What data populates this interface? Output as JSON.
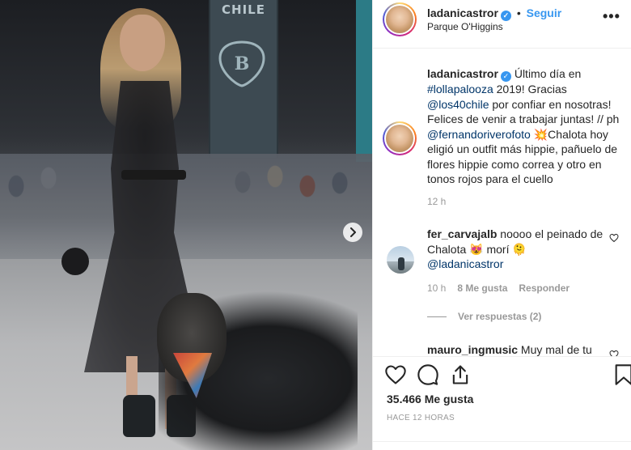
{
  "photo": {
    "banner_text": "CHILE",
    "next_icon": "chevron-right-icon"
  },
  "header": {
    "username": "ladanicastror",
    "separator": "•",
    "follow_label": "Seguir",
    "location": "Parque O'Higgins",
    "more_icon": "more-horizontal-icon",
    "more_label": "•••"
  },
  "caption": {
    "username": "ladanicastror",
    "text_1": " Último día en ",
    "hashtag": "#lollapalooza",
    "text_2": " 2019! Gracias ",
    "mention_1": "@los40chile",
    "text_3": " por confiar en nosotras! Felices de venir a trabajar juntas! // ph ",
    "mention_2": "@fernandoriverofoto",
    "emoji": "💥",
    "text_4": "Chalota hoy eligió un outfit más hippie, pañuelo de flores hippie como correa y otro en tonos rojos para el cuello",
    "time": "12 h"
  },
  "comment_1": {
    "username": "fer_carvajalb",
    "text": " noooo el peinado de Chalota ",
    "emoji": "😻",
    "text_2": " morí ",
    "trailing_glyph": "🫠",
    "mention": "@ladanicastror",
    "time": "10 h",
    "likes": "8 Me gusta",
    "reply_label": "Responder",
    "view_replies": "Ver respuestas (2)"
  },
  "comment_2": {
    "username": "mauro_ingmusic",
    "text": " Muy mal de tu"
  },
  "actions": {
    "like_icon": "heart-icon",
    "comment_icon": "comment-icon",
    "share_icon": "share-icon",
    "save_icon": "bookmark-icon",
    "likes_count": "35.466 Me gusta",
    "time_ago": "HACE 12 HORAS"
  },
  "colors": {
    "link": "#003569",
    "accent": "#3897f0",
    "muted": "#999999",
    "text": "#262626"
  }
}
